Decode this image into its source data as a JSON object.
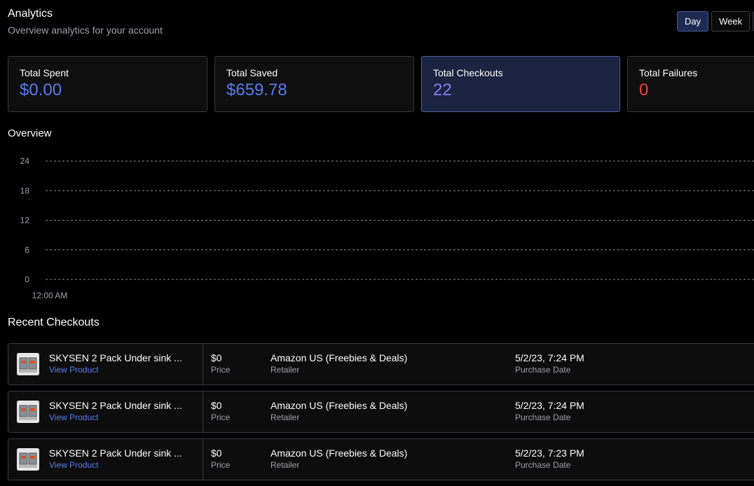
{
  "header": {
    "title": "Analytics",
    "subtitle": "Overview analytics for your account"
  },
  "range_toggle": {
    "options": [
      "Day",
      "Week",
      ""
    ],
    "selected": "Day"
  },
  "stats": [
    {
      "label": "Total Spent",
      "value": "$0.00",
      "color": "#5b7cf0"
    },
    {
      "label": "Total Saved",
      "value": "$659.78",
      "color": "#5b7cf0"
    },
    {
      "label": "Total Checkouts",
      "value": "22",
      "color": "#8b7cf0"
    },
    {
      "label": "Total Failures",
      "value": "0",
      "color": "#ef4444"
    }
  ],
  "overview": {
    "title": "Overview"
  },
  "chart_data": {
    "type": "line",
    "title": "",
    "xlabel": "",
    "ylabel": "",
    "x_ticks": [
      "12:00 AM"
    ],
    "y_ticks": [
      0,
      6,
      12,
      18,
      24
    ],
    "ylim": [
      0,
      24
    ],
    "grid": true,
    "series": []
  },
  "recent": {
    "title": "Recent Checkouts",
    "rows": [
      {
        "product": "SKYSEN 2 Pack Under sink ...",
        "link": "View Product",
        "price": "$0",
        "price_label": "Price",
        "retailer": "Amazon US (Freebies & Deals)",
        "retailer_label": "Retailer",
        "date": "5/2/23, 7:24 PM",
        "date_label": "Purchase Date"
      },
      {
        "product": "SKYSEN 2 Pack Under sink ...",
        "link": "View Product",
        "price": "$0",
        "price_label": "Price",
        "retailer": "Amazon US (Freebies & Deals)",
        "retailer_label": "Retailer",
        "date": "5/2/23, 7:24 PM",
        "date_label": "Purchase Date"
      },
      {
        "product": "SKYSEN 2 Pack Under sink ...",
        "link": "View Product",
        "price": "$0",
        "price_label": "Price",
        "retailer": "Amazon US (Freebies & Deals)",
        "retailer_label": "Retailer",
        "date": "5/2/23, 7:23 PM",
        "date_label": "Purchase Date"
      }
    ]
  }
}
